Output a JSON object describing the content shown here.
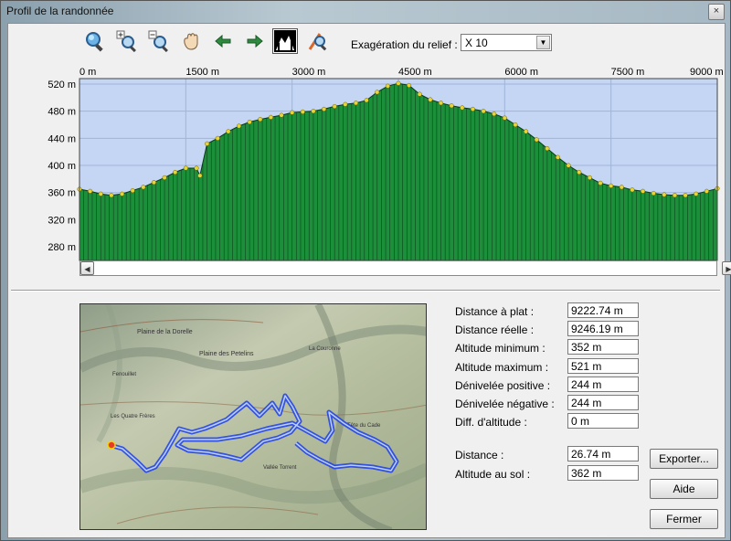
{
  "window": {
    "title": "Profil de la randonnée",
    "close_glyph": "×"
  },
  "toolbar": {
    "buttons": [
      {
        "name": "zoom-all-icon",
        "glyph": "🔍"
      },
      {
        "name": "zoom-in-icon",
        "glyph": "+"
      },
      {
        "name": "zoom-out-icon",
        "glyph": "−"
      },
      {
        "name": "pan-hand-icon",
        "glyph": "✋"
      },
      {
        "name": "arrow-left-icon",
        "glyph": "←"
      },
      {
        "name": "arrow-right-icon",
        "glyph": "→"
      },
      {
        "name": "relief-icon",
        "glyph": "▲",
        "active": true
      },
      {
        "name": "route-search-icon",
        "glyph": "⟋"
      }
    ],
    "exaggeration_label": "Exagération du relief :",
    "exaggeration_value": "X 10"
  },
  "chart_data": {
    "type": "area",
    "x_unit": "m",
    "y_unit": "m",
    "xlim": [
      0,
      9000
    ],
    "ylim": [
      260,
      528
    ],
    "x_ticks": [
      "0 m",
      "1500 m",
      "3000 m",
      "4500 m",
      "6000 m",
      "7500 m",
      "9000 m"
    ],
    "y_ticks": [
      "520 m",
      "480 m",
      "440 m",
      "400 m",
      "360 m",
      "320 m",
      "280 m"
    ],
    "grid": true,
    "colors": {
      "plot_bg": "#c5d6f4",
      "fill": "#1c8f3a",
      "stroke": "#0e4f1f",
      "points": "#e7d43b"
    },
    "x": [
      0,
      150,
      300,
      450,
      600,
      750,
      900,
      1050,
      1200,
      1350,
      1500,
      1650,
      1700,
      1800,
      1950,
      2100,
      2250,
      2400,
      2550,
      2700,
      2850,
      3000,
      3150,
      3300,
      3450,
      3600,
      3750,
      3900,
      4050,
      4200,
      4350,
      4500,
      4650,
      4800,
      4950,
      5100,
      5250,
      5400,
      5550,
      5700,
      5850,
      6000,
      6150,
      6300,
      6450,
      6600,
      6750,
      6900,
      7050,
      7200,
      7350,
      7500,
      7650,
      7800,
      7950,
      8100,
      8250,
      8400,
      8550,
      8700,
      8850,
      9000
    ],
    "y": [
      365,
      362,
      358,
      356,
      358,
      363,
      368,
      375,
      382,
      390,
      396,
      396,
      385,
      432,
      440,
      450,
      458,
      464,
      468,
      471,
      474,
      478,
      479,
      480,
      483,
      487,
      490,
      492,
      496,
      508,
      517,
      521,
      518,
      505,
      497,
      492,
      488,
      485,
      483,
      480,
      476,
      470,
      460,
      450,
      438,
      425,
      412,
      400,
      390,
      382,
      374,
      370,
      368,
      364,
      362,
      359,
      357,
      356,
      356,
      358,
      362,
      366
    ]
  },
  "stats": [
    {
      "label": "Distance à plat :",
      "value": "9222.74 m"
    },
    {
      "label": "Distance réelle :",
      "value": "9246.19 m"
    },
    {
      "label": "Altitude minimum :",
      "value": "352 m"
    },
    {
      "label": "Altitude maximum :",
      "value": "521 m"
    },
    {
      "label": "Dénivelée positive :",
      "value": "244 m"
    },
    {
      "label": "Dénivelée négative :",
      "value": "244 m"
    },
    {
      "label": "Diff. d'altitude :",
      "value": "0 m"
    }
  ],
  "cursor_stats": [
    {
      "label": "Distance :",
      "value": "26.74 m"
    },
    {
      "label": "Altitude au sol :",
      "value": "362 m"
    }
  ],
  "buttons": {
    "export": "Exporter...",
    "help": "Aide",
    "close": "Fermer"
  },
  "map": {
    "labels": [
      "Plaine de la Dorelle",
      "Plaine des Petelins",
      "La Couronne",
      "Fenouillet",
      "Les Quatre Frères",
      "Tête du Cade",
      "Vallée Torrent"
    ]
  }
}
